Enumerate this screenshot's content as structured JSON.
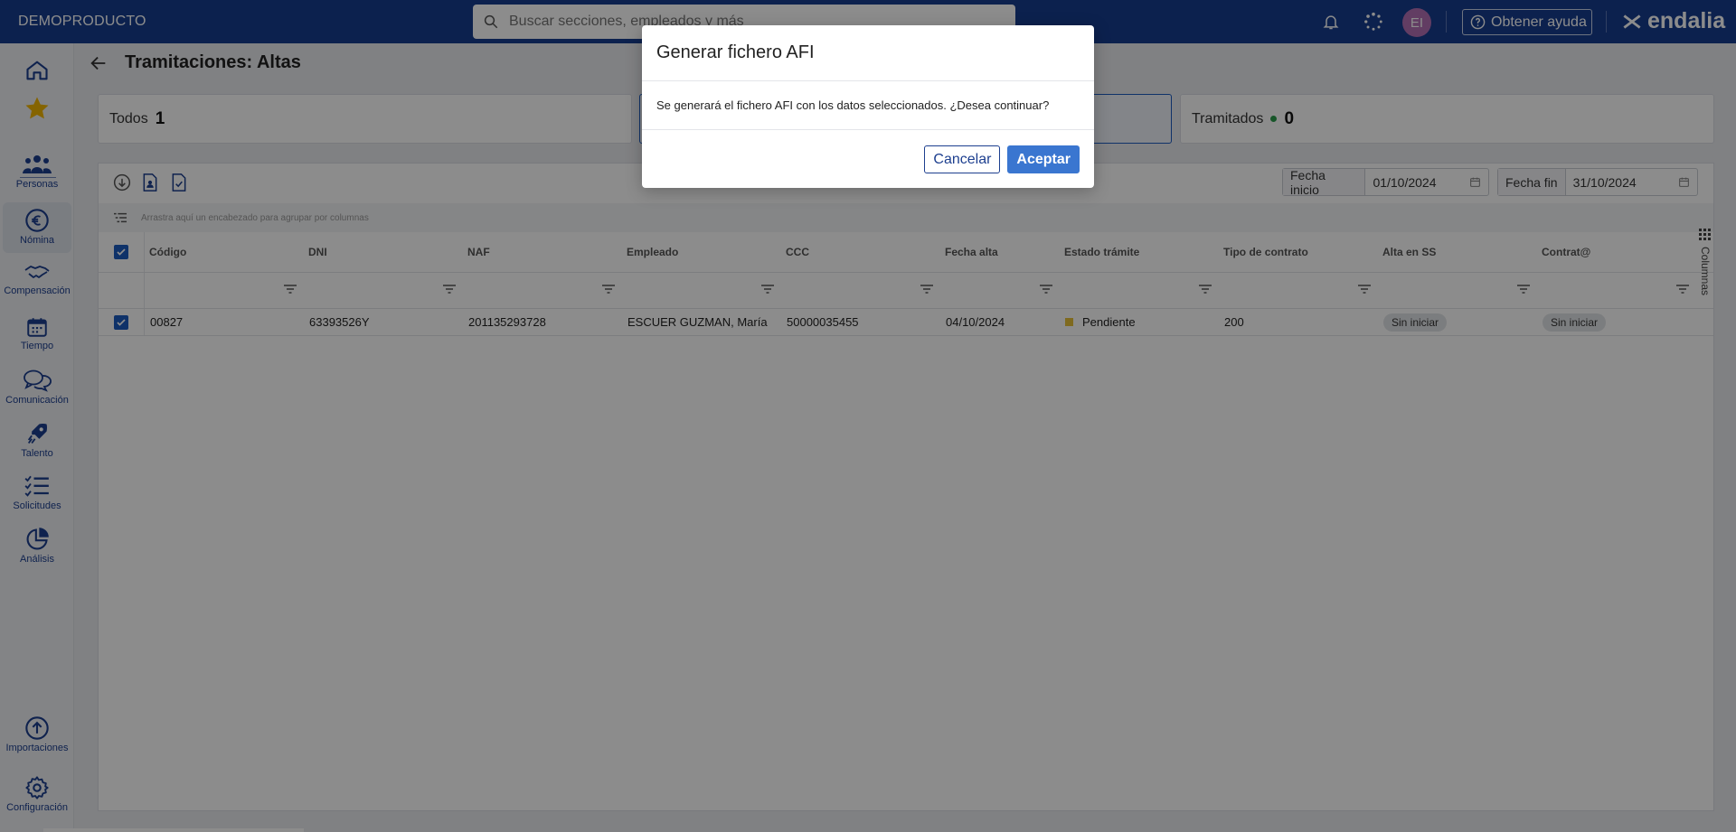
{
  "app": {
    "company": "DEMOPRODUCTO",
    "search_placeholder": "Buscar secciones, empleados y más",
    "avatar_initials": "EI",
    "help_label": "Obtener ayuda",
    "logo_text": "endalia"
  },
  "sidebar": {
    "items": [
      {
        "label": "",
        "icon": "home-icon"
      },
      {
        "label": "",
        "icon": "star-icon"
      },
      {
        "label": "Personas",
        "icon": "people-icon"
      },
      {
        "label": "Nómina",
        "icon": "euro-icon"
      },
      {
        "label": "Compensación",
        "icon": "handshake-icon"
      },
      {
        "label": "Tiempo",
        "icon": "calendar-icon"
      },
      {
        "label": "Comunicación",
        "icon": "chat-icon"
      },
      {
        "label": "Talento",
        "icon": "rocket-icon"
      },
      {
        "label": "Solicitudes",
        "icon": "checklist-icon"
      },
      {
        "label": "Análisis",
        "icon": "pie-chart-icon"
      },
      {
        "label": "Importaciones",
        "icon": "upload-icon"
      },
      {
        "label": "Configuración",
        "icon": "gear-icon"
      }
    ]
  },
  "page": {
    "title": "Tramitaciones: Altas",
    "cards": [
      {
        "label": "Todos",
        "count": "1"
      },
      {
        "label": "",
        "count": ""
      },
      {
        "label": "Tramitados",
        "count": "0"
      }
    ]
  },
  "grid": {
    "date_start_label": "Fecha inicio",
    "date_start_value": "01/10/2024",
    "date_end_label": "Fecha fin",
    "date_end_value": "31/10/2024",
    "group_hint": "Arrastra aquí un encabezado para agrupar por columnas",
    "columns_label": "Columnas",
    "headers": [
      "Código",
      "DNI",
      "NAF",
      "Empleado",
      "CCC",
      "Fecha alta",
      "Estado trámite",
      "Tipo de contrato",
      "Alta en SS",
      "Contrat@"
    ],
    "rows": [
      {
        "codigo": "00827",
        "dni": "63393526Y",
        "naf": "201135293728",
        "empleado": "ESCUER GUZMAN, María",
        "ccc": "50000035455",
        "fecha_alta": "04/10/2024",
        "estado": "Pendiente",
        "tipo_contrato": "200",
        "alta_ss": "Sin iniciar",
        "contrata": "Sin iniciar"
      }
    ]
  },
  "modal": {
    "title": "Generar fichero AFI",
    "message": "Se generará el fichero AFI con los datos seleccionados. ¿Desea continuar?",
    "cancel_label": "Cancelar",
    "accept_label": "Aceptar"
  },
  "colors": {
    "topbar": "#163c8f",
    "accent": "#1d3f8f",
    "primary_button": "#3a76d0",
    "status_pending": "#e8c23a",
    "status_done": "#2a9d4b"
  }
}
